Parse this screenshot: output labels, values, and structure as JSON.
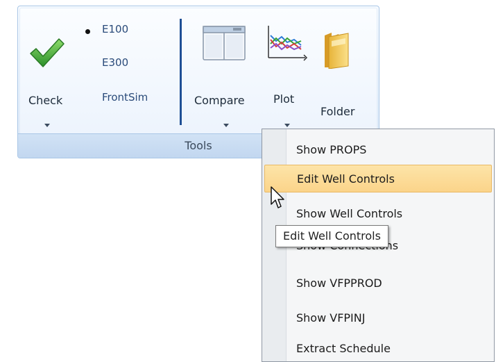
{
  "ribbon": {
    "group_label": "Tools",
    "check": {
      "label": "Check",
      "icon": "checkmark-icon",
      "color": "#3aa336"
    },
    "simulators": [
      {
        "label": "E100",
        "selected": true
      },
      {
        "label": "E300",
        "selected": false
      },
      {
        "label": "FrontSim",
        "selected": false
      }
    ],
    "compare": {
      "label": "Compare",
      "icon": "compare-window-icon"
    },
    "plot": {
      "label": "Plot",
      "icon": "line-chart-icon"
    },
    "folder": {
      "label": "Folder",
      "icon": "folder-icon"
    }
  },
  "menu": {
    "items": [
      {
        "label": "Show PROPS",
        "highlighted": false
      },
      {
        "label": "Edit Well Controls",
        "highlighted": true
      },
      {
        "label": "Show Well Controls",
        "highlighted": false
      },
      {
        "label": "Show Connections",
        "highlighted": false
      },
      {
        "label": "Show VFPPROD",
        "highlighted": false
      },
      {
        "label": "Show VFPINJ",
        "highlighted": false
      },
      {
        "label": "Extract Schedule",
        "highlighted": false
      }
    ]
  },
  "tooltip": {
    "text": "Edit Well Controls"
  },
  "colors": {
    "separator": "#1f4f95",
    "highlight": "#fbd48a",
    "ribbon_border": "#a9c6e6"
  }
}
